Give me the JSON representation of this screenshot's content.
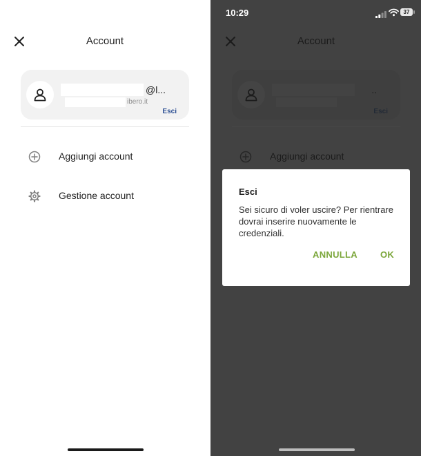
{
  "left_screen": {
    "header": {
      "title": "Account"
    },
    "account_card": {
      "email_visible_end": "@l...",
      "domain_visible_end": "ibero.it",
      "logout_label": "Esci"
    },
    "menu": [
      {
        "label": "Aggiungi account",
        "icon": "add-circle-icon"
      },
      {
        "label": "Gestione account",
        "icon": "gear-icon"
      }
    ]
  },
  "right_screen": {
    "status_bar": {
      "time": "10:29",
      "battery_percent": "37"
    },
    "header": {
      "title": "Account"
    },
    "account_card": {
      "email_visible_end": "..",
      "logout_label": "Esci"
    },
    "menu": [
      {
        "label": "Aggiungi account",
        "icon": "add-circle-icon"
      }
    ],
    "dialog": {
      "title": "Esci",
      "message": "Sei sicuro di voler uscire? Per rientrare dovrai inserire nuovamente le credenziali.",
      "cancel_label": "ANNULLA",
      "confirm_label": "OK"
    }
  },
  "colors": {
    "dialog_accent": "#7ba63a",
    "esci_link": "#2c4f93",
    "overlay": "#424242"
  }
}
